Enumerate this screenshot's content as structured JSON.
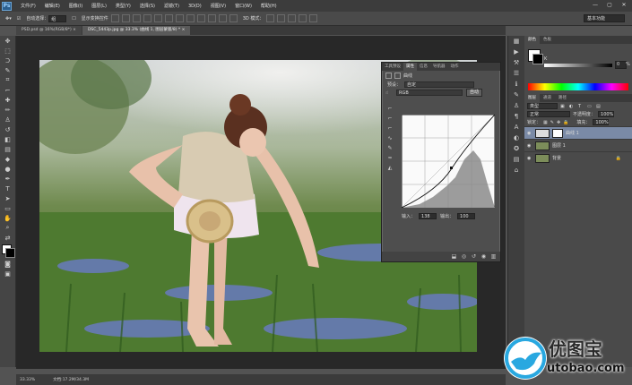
{
  "app": {
    "logo": "Ps"
  },
  "menu": [
    "文件(F)",
    "编辑(E)",
    "图像(I)",
    "图层(L)",
    "类型(Y)",
    "选择(S)",
    "滤镜(T)",
    "3D(D)",
    "视图(V)",
    "窗口(W)",
    "帮助(H)"
  ],
  "window_controls": [
    "—",
    "▢",
    "✕"
  ],
  "options_bar": {
    "auto_select_label": "自动选择：",
    "auto_select_value": "组",
    "show_transform_label": "显示变换控件",
    "mode_3d_label": "3D 模式：",
    "workspace": "基本功能"
  },
  "tabs": [
    {
      "label": "PSD.psd @ 16%(RGB/8*) ×",
      "active": false
    },
    {
      "label": "DSC_5443p.jpg @ 33.3% (曲线 1, 图层蒙版/8) * ×",
      "active": true
    }
  ],
  "curves_panel": {
    "tabs": [
      "工具预设",
      "属性",
      "信息",
      "导航器",
      "动作"
    ],
    "active_tab": "属性",
    "title": "曲线",
    "preset_label": "预设：",
    "preset_value": "自定",
    "channel_value": "RGB",
    "auto_button": "自动",
    "input_label": "输入：",
    "input_value": "138",
    "output_label": "输出：",
    "output_value": "100"
  },
  "color_panel": {
    "tabs": [
      "颜色",
      "色板"
    ],
    "k_label": "K",
    "k_value": "0",
    "percent": "%"
  },
  "layers_panel": {
    "tabs": [
      "图层",
      "通道",
      "路径"
    ],
    "kind_value": "类型",
    "blend_value": "正常",
    "opacity_label": "不透明度：",
    "opacity_value": "100%",
    "lock_label": "锁定：",
    "fill_label": "填充：",
    "fill_value": "100%",
    "layers": [
      {
        "name": "曲线 1",
        "selected": true
      },
      {
        "name": "图层 1",
        "selected": false
      },
      {
        "name": "背景",
        "selected": false
      }
    ]
  },
  "status": {
    "zoom": "33.33%",
    "doc": "文档:17.2M/34.3M"
  },
  "watermark": {
    "title": "优图宝",
    "url": "utobao.com"
  }
}
